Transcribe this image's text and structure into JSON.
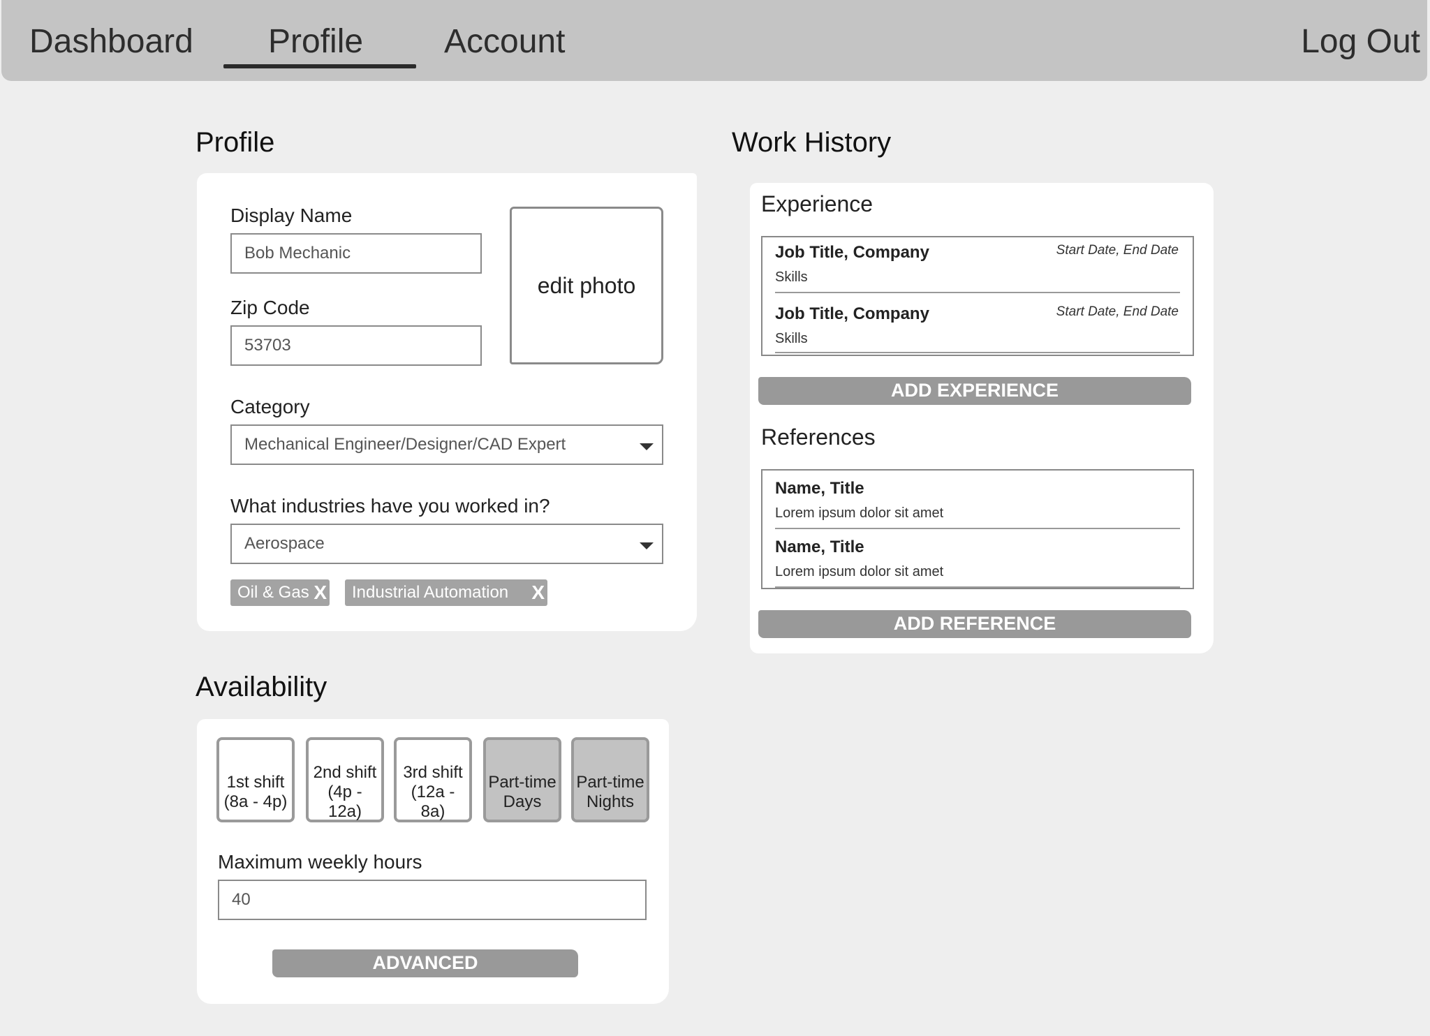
{
  "nav": {
    "items": [
      {
        "label": "Dashboard"
      },
      {
        "label": "Profile"
      },
      {
        "label": "Account"
      }
    ],
    "logout": "Log Out"
  },
  "profile": {
    "title": "Profile",
    "display_name": {
      "label": "Display Name",
      "value": "Bob Mechanic"
    },
    "zip": {
      "label": "Zip Code",
      "value": "53703"
    },
    "photo_label": "edit photo",
    "category": {
      "label": "Category",
      "value": "Mechanical Engineer/Designer/CAD Expert"
    },
    "industries": {
      "label": "What industries have you worked in?",
      "value": "Aerospace",
      "tags": [
        {
          "label": "Oil & Gas",
          "remove": "X"
        },
        {
          "label": "Industrial Automation",
          "remove": "X"
        }
      ]
    }
  },
  "work": {
    "title": "Work History",
    "experience": {
      "title": "Experience",
      "entries": [
        {
          "title": "Job Title, Company",
          "dates": "Start Date, End Date",
          "sub": "Skills"
        },
        {
          "title": "Job Title, Company",
          "dates": "Start Date, End Date",
          "sub": "Skills"
        }
      ],
      "add_label": "ADD EXPERIENCE"
    },
    "references": {
      "title": "References",
      "entries": [
        {
          "title": "Name, Title",
          "sub": "Lorem ipsum dolor sit amet"
        },
        {
          "title": "Name, Title",
          "sub": "Lorem ipsum dolor sit amet"
        }
      ],
      "add_label": "ADD REFERENCE"
    }
  },
  "availability": {
    "title": "Availability",
    "shifts": [
      {
        "line1": "1st shift",
        "line2": "(8a - 4p)",
        "selected": false
      },
      {
        "line1": "2nd shift",
        "line2": "(4p - 12a)",
        "selected": false
      },
      {
        "line1": "3rd shift",
        "line2": "(12a - 8a)",
        "selected": false
      },
      {
        "line1": "Part-time",
        "line2": "Days",
        "selected": true
      },
      {
        "line1": "Part-time",
        "line2": "Nights",
        "selected": true
      }
    ],
    "max_hours": {
      "label": "Maximum weekly hours",
      "value": "40"
    },
    "advanced_label": "ADVANCED"
  }
}
